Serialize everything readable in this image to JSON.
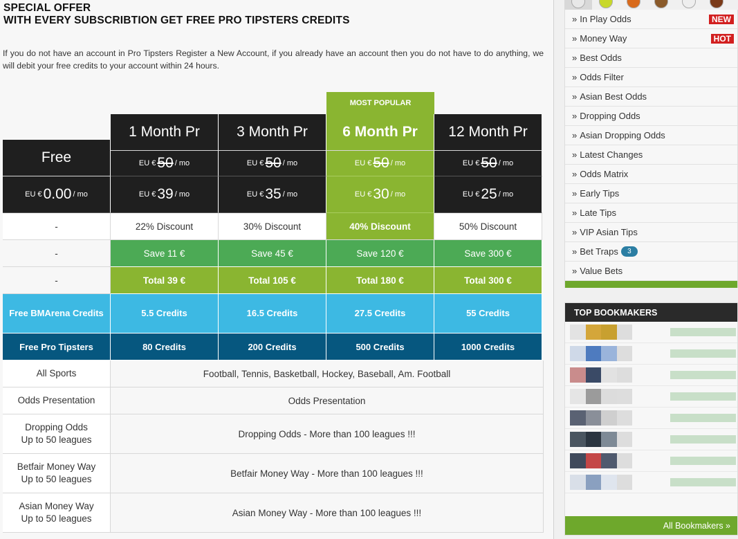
{
  "offer": {
    "title_line1": "SPECIAL OFFER",
    "title_line2": "WITH EVERY SUBSCRIBTION GET FREE PRO TIPSTERS CREDITS",
    "text": "If you do not have an account in Pro Tipsters Register a New Account, if you already have an account then you do not have to do anything, we will debit your free credits to your account within 24 hours."
  },
  "pricing": {
    "popular_label": "MOST POPULAR",
    "currency_prefix": "EU €",
    "per_mo": "/ mo",
    "plans": [
      {
        "name": "Free",
        "price": "0.00",
        "old_price": "",
        "discount": "-",
        "save": "-",
        "total": "-",
        "bma": "Free BMArena Credits",
        "pro": "Free Pro Tipsters"
      },
      {
        "name": "1 Month Pr",
        "old_price": "50",
        "price": "39",
        "discount": "22% Discount",
        "save": "Save 11 €",
        "total": "Total 39 €",
        "bma": "5.5 Credits",
        "pro": "80 Credits"
      },
      {
        "name": "3 Month Pr",
        "old_price": "50",
        "price": "35",
        "discount": "30% Discount",
        "save": "Save 45 €",
        "total": "Total 105 €",
        "bma": "16.5 Credits",
        "pro": "200 Credits"
      },
      {
        "name": "6 Month Pr",
        "old_price": "50",
        "price": "30",
        "discount": "40% Discount",
        "save": "Save 120 €",
        "total": "Total 180 €",
        "bma": "27.5 Credits",
        "pro": "500 Credits"
      },
      {
        "name": "12 Month Pr",
        "old_price": "50",
        "price": "25",
        "discount": "50% Discount",
        "save": "Save 300 €",
        "total": "Total 300 €",
        "bma": "55 Credits",
        "pro": "1000 Credits"
      }
    ],
    "features": [
      {
        "label": "All Sports",
        "label2": "",
        "value": "Football, Tennis, Basketball, Hockey, Baseball, Am. Football"
      },
      {
        "label": "Odds Presentation",
        "label2": "",
        "value": "Odds Presentation"
      },
      {
        "label": "Dropping Odds",
        "label2": "Up to 50 leagues",
        "value": "Dropping Odds - More than 100 leagues !!!"
      },
      {
        "label": "Betfair Money Way",
        "label2": "Up to 50 leagues",
        "value": "Betfair Money Way - More than 100 leagues !!!"
      },
      {
        "label": "Asian Money Way",
        "label2": "Up to 50 leagues",
        "value": "Asian Money Way - More than 100 leagues !!!"
      }
    ]
  },
  "sidebar": {
    "sports": [
      {
        "icon": "soccer-ball-icon",
        "color": "#e8e8e8"
      },
      {
        "icon": "tennis-ball-icon",
        "color": "#c8d82a"
      },
      {
        "icon": "basketball-icon",
        "color": "#d86a1c"
      },
      {
        "icon": "hockey-icon",
        "color": "#8a5a2a"
      },
      {
        "icon": "baseball-icon",
        "color": "#eeeeee"
      },
      {
        "icon": "american-football-icon",
        "color": "#7a3a18"
      }
    ],
    "nav": [
      {
        "label": "In Play Odds",
        "tag": "NEW"
      },
      {
        "label": "Money Way",
        "tag": "HOT"
      },
      {
        "label": "Best Odds"
      },
      {
        "label": "Odds Filter"
      },
      {
        "label": "Asian Best Odds"
      },
      {
        "label": "Dropping Odds"
      },
      {
        "label": "Asian Dropping Odds"
      },
      {
        "label": "Latest Changes"
      },
      {
        "label": "Odds Matrix"
      },
      {
        "label": "Early Tips"
      },
      {
        "label": "Late Tips"
      },
      {
        "label": "VIP Asian Tips"
      },
      {
        "label": "Bet Traps",
        "count": "3"
      },
      {
        "label": "Value Bets"
      }
    ],
    "raquo": "»",
    "bookmakers_title": "TOP BOOKMAKERS",
    "bookmakers_footer": "All Bookmakers »",
    "bookmaker_logos": [
      [
        "#e3e3e3",
        "#d4a63a",
        "#c8a030",
        "#ddd"
      ],
      [
        "#cfd9e8",
        "#4e7bbf",
        "#9ab4db",
        "#ddd"
      ],
      [
        "#c98c8c",
        "#3a4a66",
        "#e2e2e2",
        "#ddd"
      ],
      [
        "#e5e5e5",
        "#9b9b9b",
        "#dcdcdc",
        "#ddd"
      ],
      [
        "#5a6273",
        "#8a8f99",
        "#cfcfcf",
        "#ddd"
      ],
      [
        "#4a5560",
        "#2b3540",
        "#7e8a96",
        "#ddd"
      ],
      [
        "#404a5c",
        "#c44747",
        "#4f5a6e",
        "#ddd"
      ],
      [
        "#d9dfe8",
        "#8aa0c0",
        "#dfe5ee",
        "#ddd"
      ]
    ]
  }
}
